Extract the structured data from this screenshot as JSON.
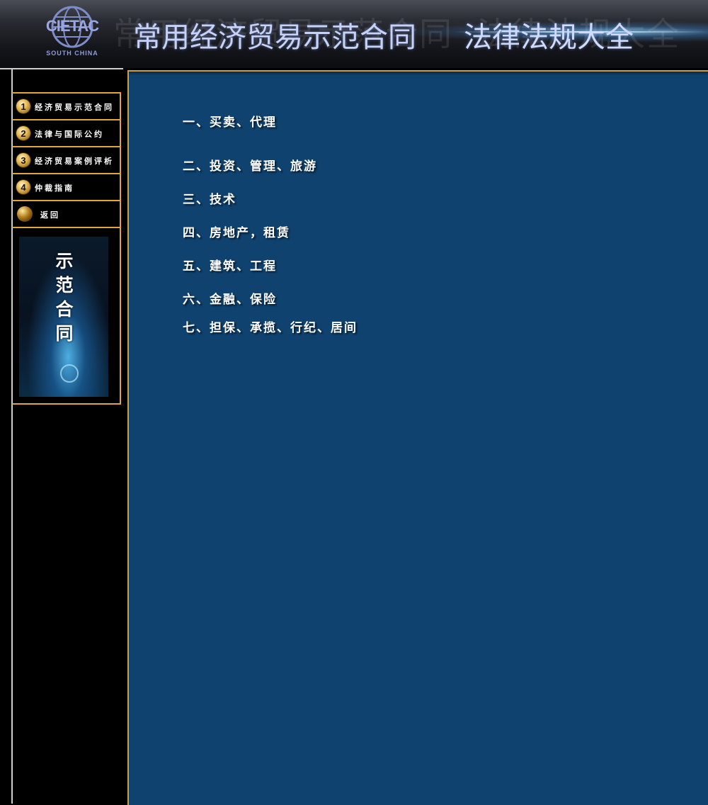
{
  "header": {
    "logo_text": "CIETAC",
    "logo_subtext": "SOUTH  CHINA",
    "title": "常用经济贸易示范合同",
    "subtitle": "法律法规大全"
  },
  "sidebar": {
    "items": [
      {
        "number": "1",
        "label": "经济贸易示范合同"
      },
      {
        "number": "2",
        "label": "法律与国际公约"
      },
      {
        "number": "3",
        "label": "经济贸易案例评析"
      },
      {
        "number": "4",
        "label": "仲裁指南"
      },
      {
        "number": "",
        "label": "返回"
      }
    ],
    "promo_text": "示范合同"
  },
  "main": {
    "categories": [
      "一、买卖、代理",
      "二、投资、管理、旅游",
      "三、技术",
      "四、房地产，租赁",
      "五、建筑、工程",
      "六、金融、保险",
      "七、担保、承揽、行纪、居间"
    ]
  },
  "colors": {
    "content_bg": "#10426f",
    "accent_border": "#e0a63a",
    "title_text": "#c7d2f6"
  }
}
